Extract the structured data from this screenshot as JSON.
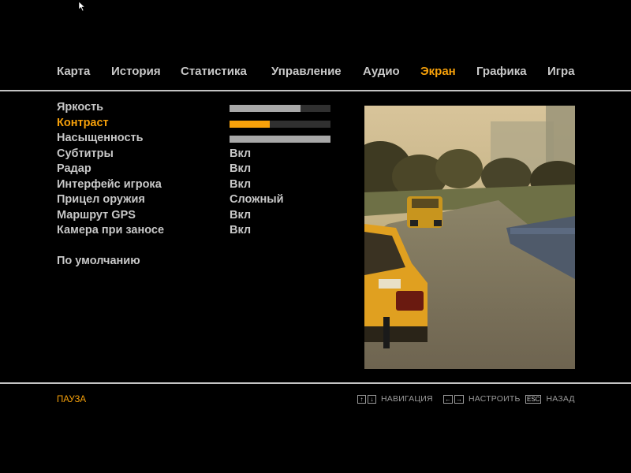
{
  "tabs": [
    "Карта",
    "История",
    "Статистика",
    "Управление",
    "Аудио",
    "Экран",
    "Графика",
    "Игра"
  ],
  "active_tab": "Экран",
  "settings": [
    {
      "label": "Яркость",
      "type": "slider",
      "level": 0.7
    },
    {
      "label": "Контраст",
      "type": "slider",
      "level": 0.4,
      "active": true
    },
    {
      "label": "Насыщенность",
      "type": "slider",
      "level": 1.0
    },
    {
      "label": "Субтитры",
      "value": "Вкл"
    },
    {
      "label": "Радар",
      "value": "Вкл"
    },
    {
      "label": "Интерфейс игрока",
      "value": "Вкл"
    },
    {
      "label": "Прицел оружия",
      "value": "Сложный"
    },
    {
      "label": "Маршрут GPS",
      "value": "Вкл"
    },
    {
      "label": "Камера при заносе",
      "value": "Вкл"
    }
  ],
  "defaults_label": "По умолчанию",
  "footer": {
    "pause": "ПАУЗА",
    "hints": {
      "navigate": {
        "keys": [
          "↑",
          "↓"
        ],
        "label": "НАВИГАЦИЯ"
      },
      "adjust": {
        "keys": [
          "←",
          "→"
        ],
        "label": "НАСТРОИТЬ"
      },
      "back": {
        "keys": [
          "ESC"
        ],
        "label": "НАЗАД"
      }
    }
  },
  "colors": {
    "accent": "#f7a10a",
    "text": "#c8c8c8",
    "background": "#000000"
  }
}
